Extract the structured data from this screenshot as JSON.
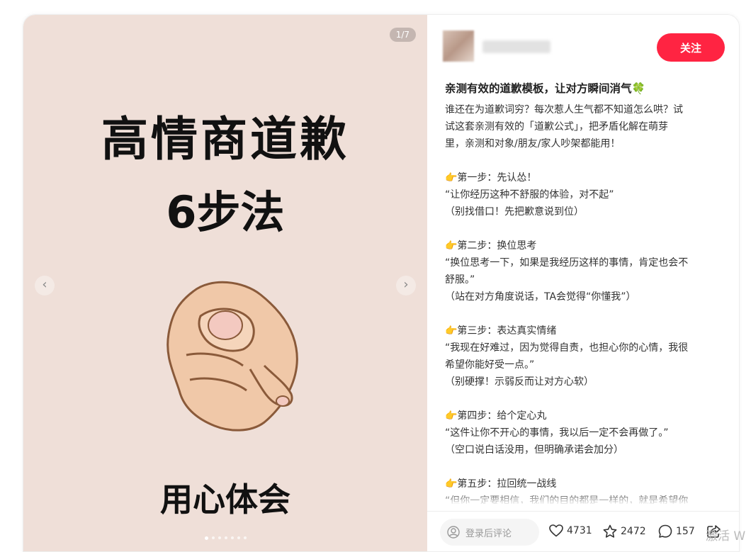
{
  "image_panel": {
    "page_counter": "1/7",
    "title_line1": "高情商道歉",
    "title_line2": "6步法",
    "footer_text": "用心体会",
    "dots_count": 7,
    "active_dot": 0,
    "background": "#efdfd8"
  },
  "author": {
    "follow_label": "关注",
    "follow_color": "#ff2442"
  },
  "note": {
    "title": "亲测有效的道歉模板，让对方瞬间消气🍀",
    "lines": [
      "谁还在为道歉词穷？每次惹人生气都不知道怎么哄？试",
      "试这套亲测有效的「道歉公式」，把矛盾化解在萌芽",
      "里，亲测和对象/朋友/家人吵架都能用！",
      "",
      "👉第一步：先认怂！",
      "“让你经历这种不舒服的体验，对不起”",
      "（别找借口！先把歉意说到位）",
      "",
      "👉第二步：换位思考",
      "“换位思考一下，如果是我经历这样的事情，肯定也会不",
      "舒服。”",
      "（站在对方角度说话，TA会觉得“你懂我”）",
      "",
      "👉第三步：表达真实情绪",
      "“我现在好难过，因为觉得自责，也担心你的心情，我很",
      "希望你能好受一点。”",
      "（别硬撑！示弱反而让对方心软）",
      "",
      "👉第四步：给个定心丸",
      "“这件让你不开心的事情，我以后一定不会再做了。”",
      "（空口说白话没用，但明确承诺会加分）",
      "",
      "👉第五步：拉回统一战线",
      "“但你一定要相信，我们的目的都是一样的，就是希望你"
    ]
  },
  "bottom_bar": {
    "comment_placeholder": "登录后评论",
    "likes": "4731",
    "collects": "2472",
    "comments": "157"
  },
  "watermark": "激活 W"
}
